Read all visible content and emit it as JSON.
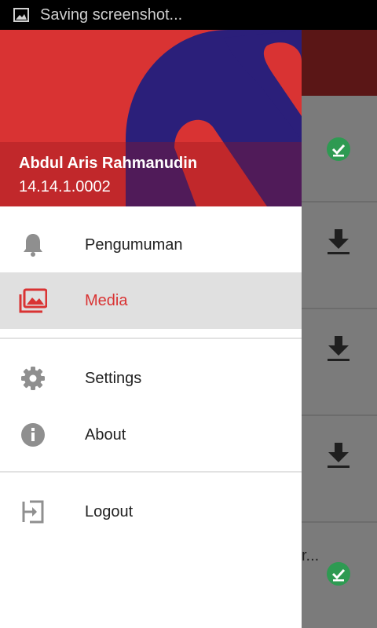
{
  "status_bar": {
    "icon": "image-icon",
    "text": "Saving screenshot..."
  },
  "drawer": {
    "header": {
      "user_name": "Abdul Aris Rahmanudin",
      "user_id": "14.14.1.0002",
      "brand_color": "#d93333",
      "logo_color": "#2b1f7a"
    },
    "items": [
      {
        "label": "Pengumuman",
        "icon": "bell-icon",
        "active": false
      },
      {
        "label": "Media",
        "icon": "photo-library-icon",
        "active": true
      },
      {
        "label": "Settings",
        "icon": "gear-icon",
        "active": false
      },
      {
        "label": "About",
        "icon": "info-icon",
        "active": false
      },
      {
        "label": "Logout",
        "icon": "exit-icon",
        "active": false
      }
    ]
  },
  "background": {
    "rows": [
      {
        "icon": "check-circle-icon"
      },
      {
        "icon": "download-icon"
      },
      {
        "icon": "download-icon"
      },
      {
        "icon": "download-icon"
      },
      {
        "icon": "check-circle-icon",
        "text_fragment": "r..."
      }
    ]
  }
}
